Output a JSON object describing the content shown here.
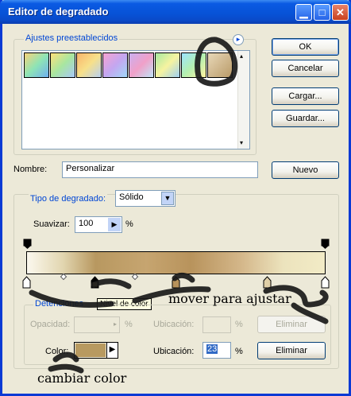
{
  "window": {
    "title": "Editor de degradado"
  },
  "presets": {
    "legend": "Ajustes preestablecidos",
    "swatch_gradients": [
      "linear-gradient(135deg,#f8d27a,#8ee4b5,#6fb0f0)",
      "linear-gradient(135deg,#ffe07a,#a8e6a0,#a8c8f8)",
      "linear-gradient(135deg,#f9b46a,#f7e08a,#b8d0f0)",
      "linear-gradient(135deg,#f7a3d0,#c4a6f0,#a0d8f8)",
      "linear-gradient(135deg,#cab0f0,#f0a0c8,#c0e4f8)",
      "linear-gradient(135deg,#a6e8a0,#f6f3a0,#a0d0f0)",
      "linear-gradient(135deg,#9de4ff,#b4f0b0,#fff2a0)",
      "linear-gradient(135deg,#e8d8b8,#b99a68)"
    ]
  },
  "buttons": {
    "ok": "OK",
    "cancel": "Cancelar",
    "load": "Cargar...",
    "save": "Guardar...",
    "new": "Nuevo",
    "delete": "Eliminar"
  },
  "name_field": {
    "label": "Nombre:",
    "value": "Personalizar"
  },
  "gradient_type": {
    "label": "Tipo de degradado:",
    "value": "Sólido"
  },
  "smoothness": {
    "label": "Suavizar:",
    "value": "100",
    "unit": "%"
  },
  "stops": {
    "legend": "Detenciones",
    "opacity_label": "Opacidad:",
    "opacity_unit": "%",
    "location_label": "Ubicación:",
    "location_unit": "%",
    "color_label": "Color:",
    "color_value": "#b89a60",
    "color_location_label": "Ubicación:",
    "color_location_value": "23",
    "color_location_unit": "%"
  },
  "tooltip": "Nivel de color",
  "annotations": {
    "move": "mover para ajustar",
    "change_color": "cambiar color"
  }
}
